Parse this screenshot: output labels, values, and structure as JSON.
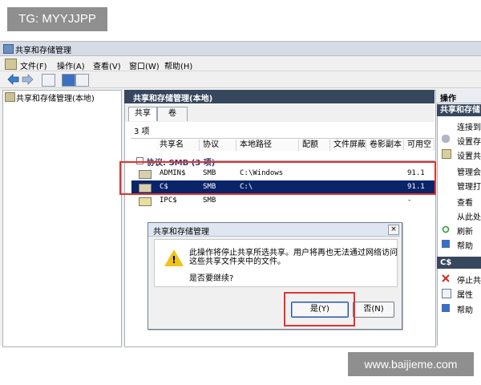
{
  "watermark_top": "TG: MYYJJPP",
  "watermark_bottom": "www.baijieme.com",
  "window": {
    "title": "共享和存储管理"
  },
  "menu": {
    "file": "文件(F)",
    "action": "操作(A)",
    "view": "查看(V)",
    "window": "窗口(W)",
    "help": "帮助(H)"
  },
  "tree": {
    "root": "共享和存储管理(本地)"
  },
  "main": {
    "header": "共享和存储管理(本地)",
    "tabs": [
      "共享",
      "卷"
    ],
    "count": "3 项",
    "columns": [
      "共享名",
      "协议",
      "本地路径",
      "配额",
      "文件屏蔽",
      "卷影副本",
      "可用空"
    ],
    "group_label": "协议: SMB (3 项)",
    "rows": [
      {
        "name": "ADMIN$",
        "protocol": "SMB",
        "path": "C:\\Windows",
        "free": "91.1"
      },
      {
        "name": "C$",
        "protocol": "SMB",
        "path": "C:\\",
        "free": "91.1"
      },
      {
        "name": "IPC$",
        "protocol": "SMB",
        "path": "",
        "free": "-"
      }
    ]
  },
  "actions": {
    "header": "操作",
    "section1": "共享和存储",
    "items1": [
      "连接到",
      "设置存",
      "设置共",
      "管理会",
      "管理打",
      "查看",
      "从此处",
      "刷新",
      "帮助"
    ],
    "section2": "C$",
    "items2": [
      "停止共",
      "属性",
      "帮助"
    ]
  },
  "dialog": {
    "title": "共享和存储管理",
    "message_line1": "此操作将停止共享所选共享。用户将再也无法通过网络访问",
    "message_line2": "这些共享文件夹中的文件。",
    "question": "是否要继续?",
    "yes": "是(Y)",
    "no": "否(N)",
    "close": "×"
  },
  "colors": {
    "selection": "#0a246a",
    "highlight": "#e0332e",
    "header": "#37475e"
  }
}
